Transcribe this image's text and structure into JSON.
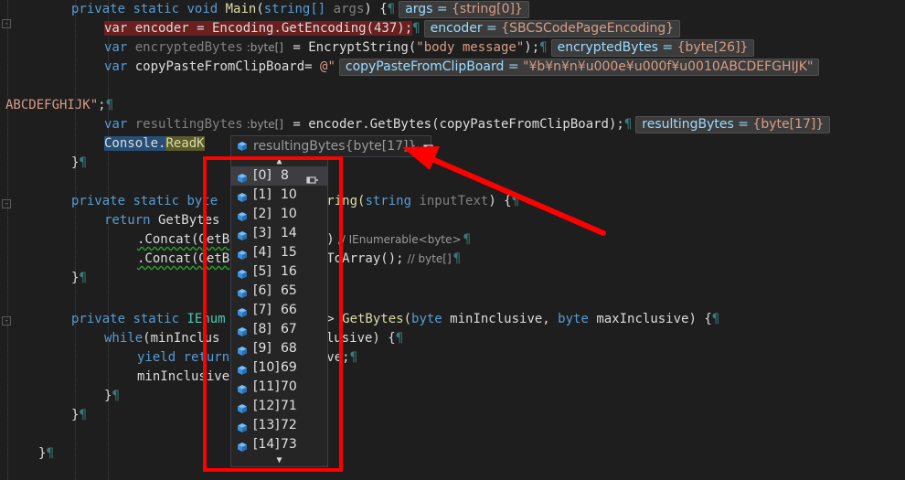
{
  "editor": {
    "lines": {
      "main_sig": {
        "kw1": "private",
        "kw2": "static",
        "kw3": "void",
        "name": "Main",
        "open": "(",
        "type": "string[]",
        "param": "args",
        "close": ") {",
        "tip_label": "args = ",
        "tip_value": "{string[0]}"
      },
      "encoder": {
        "text": "var encoder = Encoding.GetEncoding(437);",
        "tip_label": "encoder = ",
        "tip_value": "{SBCSCodePageEncoding}"
      },
      "encrypted": {
        "kw": "var",
        "name": "encryptedBytes",
        "hint": ":byte[]",
        "rest": " = EncryptString(",
        "str": "\"body message\"",
        "end": ");",
        "tip_label": "encryptedBytes = ",
        "tip_value": "{byte[26]}"
      },
      "copypaste": {
        "kw": "var",
        "rest": " copyPasteFromClipBoard= ",
        "str": "@\"",
        "tip_label": "copyPasteFromClipBoard = ",
        "tip_value": "\"¥b¥n¥n¥u000e¥u000f¥u0010ABCDEFGHIJK\""
      },
      "abc": {
        "str": "ABCDEFGHIJK\"",
        "end": ";"
      },
      "resulting": {
        "kw": "var",
        "name": "resultingBytes",
        "hint": ":byte[]",
        "rest": " = encoder.GetBytes(copyPasteFromClipBoard);",
        "tip_label": "resultingBytes = ",
        "tip_value": "{byte[17]}"
      },
      "console": {
        "cls": "Console",
        "dot": ".",
        "method": "ReadK"
      },
      "brace_close1": "}",
      "encrypt_sig": {
        "kw1": "private",
        "kw2": "static",
        "kw3": "byte",
        "frag": "tString(",
        "type": "string",
        "param": "inputText",
        "close": ") {"
      },
      "return_line": {
        "kw": "return",
        "rest": " GetBytes"
      },
      "concat1": {
        "text": ".Concat(GetB",
        "tail": "75))",
        "comment": "// IEnumerable<byte>"
      },
      "concat2": {
        "text": ".Concat(GetB",
        "tail": ")).ToArray();",
        "comment": "// byte[]"
      },
      "brace_close2": "}",
      "getbytes_sig": {
        "kw1": "private",
        "kw2": "static",
        "frag": "IEnum",
        "frag2": "yte>",
        "name": " GetBytes(",
        "t1": "byte",
        "p1": " minInclusive, ",
        "t2": "byte",
        "p2": " maxInclusive) {"
      },
      "while_line": {
        "kw": "while",
        "rest": "(minInclus",
        "tail": "nclusive) {"
      },
      "yield_line": {
        "kw1": "yield",
        "kw2": "return",
        "tail": "usive;"
      },
      "mininc_line": {
        "text": "minInclusive"
      },
      "brace_close3": "}",
      "brace_close4": "}",
      "brace_close5": "}"
    },
    "pilcrow": "¶"
  },
  "datatip": {
    "label": "resultingBytes",
    "value": "{byte[17]}",
    "icon": "cube-icon",
    "pin_icon": "pin-icon",
    "items": [
      {
        "index": "[0]",
        "value": "8"
      },
      {
        "index": "[1]",
        "value": "10"
      },
      {
        "index": "[2]",
        "value": "10"
      },
      {
        "index": "[3]",
        "value": "14"
      },
      {
        "index": "[4]",
        "value": "15"
      },
      {
        "index": "[5]",
        "value": "16"
      },
      {
        "index": "[6]",
        "value": "65"
      },
      {
        "index": "[7]",
        "value": "66"
      },
      {
        "index": "[8]",
        "value": "67"
      },
      {
        "index": "[9]",
        "value": "68"
      },
      {
        "index": "[10]",
        "value": "69"
      },
      {
        "index": "[11]",
        "value": "70"
      },
      {
        "index": "[12]",
        "value": "71"
      },
      {
        "index": "[13]",
        "value": "72"
      },
      {
        "index": "[14]",
        "value": "73"
      }
    ],
    "scroll_up": "▲",
    "scroll_down": "▼"
  },
  "colors": {
    "annotation": "#ff0000",
    "background": "#1e1e1e"
  }
}
